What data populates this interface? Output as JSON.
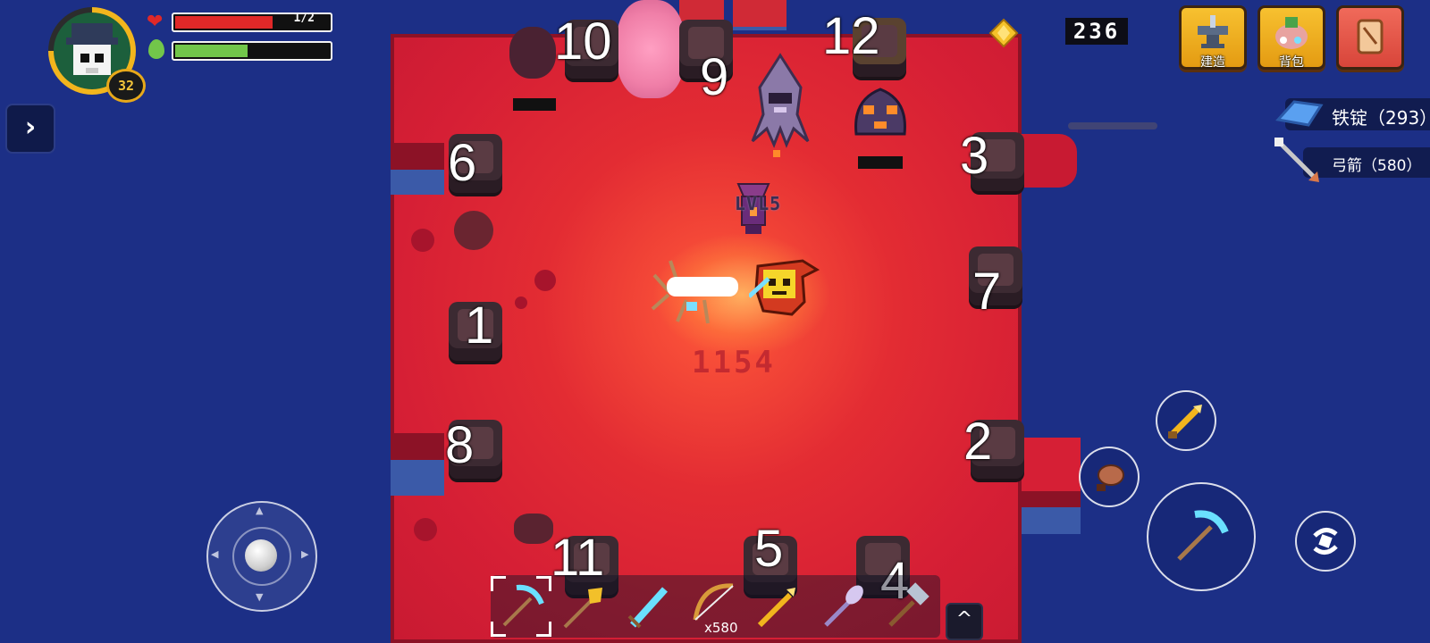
{
  "hud": {
    "level": "32",
    "health_text": "1/2",
    "health_fraction": 0.62,
    "energy_fraction": 0.46,
    "colors": {
      "health": "#e02828",
      "energy": "#72c64a",
      "level_ring": "#f2b51d"
    }
  },
  "side_toggle": {
    "icon": "chevron-right-icon",
    "glyph": "›"
  },
  "currency": {
    "icon": "gold-gem-icon",
    "amount": "236"
  },
  "top_buttons": [
    {
      "id": "build",
      "label": "建造",
      "icon": "anvil-icon"
    },
    {
      "id": "backpack",
      "label": "背包",
      "icon": "backpack-icon"
    },
    {
      "id": "map",
      "label": "",
      "icon": "scroll-map-icon"
    }
  ],
  "resources": [
    {
      "label": "铁锭（293）",
      "icon": "iron-ingot-icon"
    },
    {
      "label": "弓箭（580）",
      "icon": "arrow-icon"
    }
  ],
  "pillars": [
    "1",
    "2",
    "3",
    "4",
    "5",
    "6",
    "7",
    "8",
    "9",
    "10",
    "11",
    "12"
  ],
  "world": {
    "enemy_level_label": "LVL5",
    "damage_number": "1154"
  },
  "hotbar": {
    "slots": [
      {
        "icon": "diamond-pickaxe-icon",
        "selected": true
      },
      {
        "icon": "golden-shovel-icon"
      },
      {
        "icon": "ice-sword-icon"
      },
      {
        "icon": "bow-icon",
        "count": "x580"
      },
      {
        "icon": "golden-dagger-icon"
      },
      {
        "icon": "crystal-staff-icon"
      },
      {
        "icon": "iron-hammer-icon"
      }
    ],
    "expand_glyph": "^"
  },
  "actions": {
    "quick_weapon": "golden-dagger-icon",
    "food": "cooked-fish-icon",
    "primary": "diamond-pickaxe-icon",
    "swap": "swap-icon"
  }
}
